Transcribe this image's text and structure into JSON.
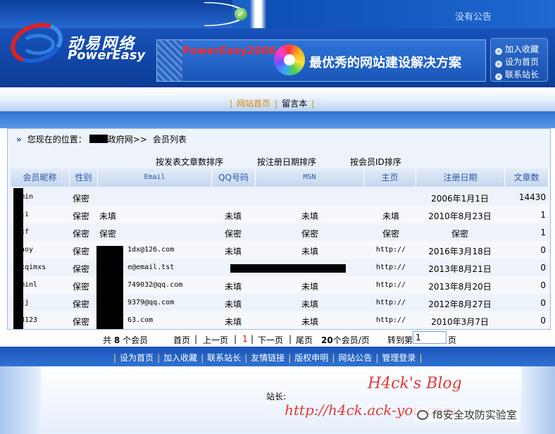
{
  "topbar": {
    "notice": "没有公告",
    "check_icon": "check-circle-icon"
  },
  "logo": {
    "cn": "动易网络",
    "en": "PowerEasy"
  },
  "banner": {
    "product": "PowerEasy2006",
    "slogan": "最优秀的网站建设解决方案"
  },
  "quicklinks": [
    {
      "label": "加入收藏",
      "icon": "arrow-circle-icon"
    },
    {
      "label": "设为首页",
      "icon": "arrow-circle-icon"
    },
    {
      "label": "联系站长",
      "icon": "arrow-circle-icon"
    }
  ],
  "nav": {
    "home": "网站首页",
    "guestbook": "留言本"
  },
  "breadcrumb": {
    "prefix": "您现在的位置：",
    "site": "政府网>>",
    "current": "会员列表"
  },
  "sort": {
    "by_articles": "按发表文章数排序",
    "by_regdate": "按注册日期排序",
    "by_id": "按会员ID排序"
  },
  "table": {
    "headers": {
      "nickname": "会员昵称",
      "gender": "性别",
      "email": "Email",
      "qq": "QQ号码",
      "msn": "MSN",
      "homepage": "主页",
      "regdate": "注册日期",
      "articles": "文章数"
    },
    "rows": [
      {
        "name": "min",
        "gender": "保密",
        "email": "",
        "qq": "",
        "msn": "",
        "home": "",
        "date": "2006年1月1日",
        "count": "14430"
      },
      {
        "name": "li",
        "gender": "保密",
        "email": "未填",
        "qq": "未填",
        "msn": "未填",
        "home": "未填",
        "date": "2010年8月23日",
        "count": "1"
      },
      {
        "name": "xf",
        "gender": "保密",
        "email": "保密",
        "qq": "保密",
        "msn": "保密",
        "home": "保密",
        "date": "保密",
        "count": "1"
      },
      {
        "name": "aoy",
        "gender": "保密",
        "email": "1dx@126.com",
        "qq": "未填",
        "msn": "未填",
        "home": "http://",
        "date": "2016年3月18日",
        "count": "0"
      },
      {
        "name": "xqimxs",
        "gender": "保密",
        "email": "e@email.tst",
        "qq": "",
        "msn": "",
        "home": "http://",
        "date": "2013年8月21日",
        "count": "0"
      },
      {
        "name": "minl",
        "gender": "保密",
        "email": "749032@qq.com",
        "qq": "未填",
        "msn": "未填",
        "home": "http://",
        "date": "2013年8月20日",
        "count": "0"
      },
      {
        "name": "cj",
        "gender": "保密",
        "email": "9379@qq.com",
        "qq": "未填",
        "msn": "未填",
        "home": "http://",
        "date": "2012年8月27日",
        "count": "0"
      },
      {
        "name": "8123",
        "gender": "保密",
        "email": "63.com",
        "qq": "未填",
        "msn": "未填",
        "home": "http://",
        "date": "2010年3月7日",
        "count": "0"
      }
    ]
  },
  "pager": {
    "total_prefix": "共",
    "total": "8",
    "total_suffix": "个会员",
    "first": "首页",
    "prev": "上一页",
    "current": "1",
    "next": "下一页",
    "last": "尾页",
    "per_page": "20",
    "per_page_suffix": "个会员/页",
    "jump_label": "转到第",
    "jump_value": "1",
    "jump_suffix": "页"
  },
  "footer_nav": [
    "设为首页",
    "加入收藏",
    "联系站长",
    "友情链接",
    "版权申明",
    "网站公告",
    "管理登录"
  ],
  "footer": {
    "webmaster": "站长:"
  },
  "watermark": {
    "line1": "H4ck's  Blog",
    "line2": "http://h4ck.ack-you.com",
    "badge": "f8安全攻防实验室"
  }
}
